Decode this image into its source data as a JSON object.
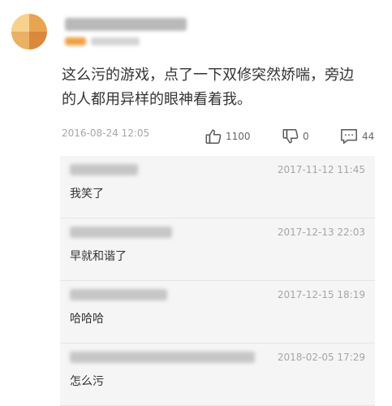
{
  "post": {
    "text_line1": "这么污的游戏，点了一下双修突然娇喘，旁边",
    "text_line2": "的人都用异样的眼神看着我。",
    "timestamp": "2016-08-24 12:05",
    "likes": "1100",
    "dislikes": "0",
    "comments": "44"
  },
  "replies": [
    {
      "time": "2017-11-12 11:45",
      "text": "我笑了"
    },
    {
      "time": "2017-12-13 22:03",
      "text": "早就和谐了"
    },
    {
      "time": "2017-12-15 18:19",
      "text": "哈哈哈"
    },
    {
      "time": "2018-02-05 17:29",
      "text": "怎么污"
    }
  ],
  "icons": {
    "like": "thumbs-up-icon",
    "dislike": "thumbs-down-icon",
    "comment": "comment-bubble-icon"
  }
}
